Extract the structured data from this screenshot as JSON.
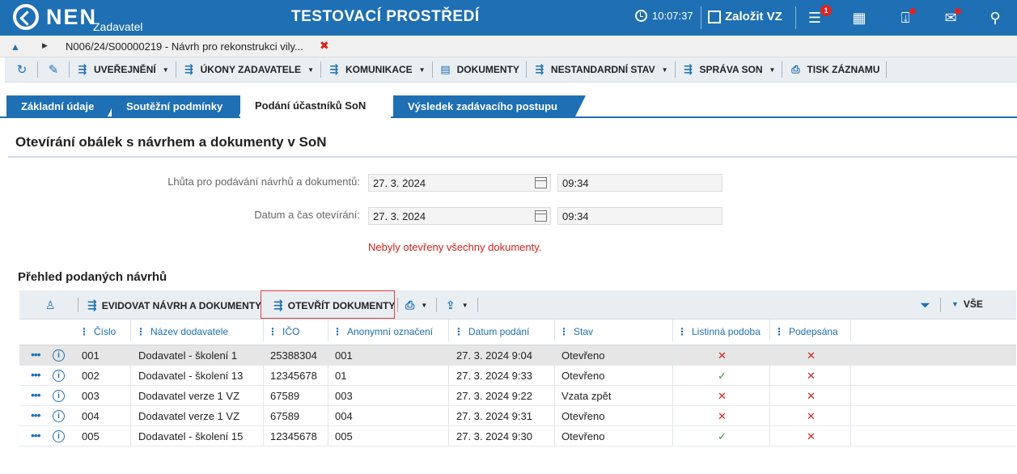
{
  "header": {
    "brand": "NEN",
    "brand_sub": "Zadavatel",
    "env_title": "TESTOVACÍ PROSTŘEDÍ",
    "clock": "10:07:37",
    "create_label": "Založit VZ",
    "tasks_badge": "1"
  },
  "breadcrumb": {
    "text": "N006/24/S00000219 - Návrh pro rekonstrukci vily...",
    "close": "✖"
  },
  "toolbar": {
    "items": [
      {
        "label": "UVEŘEJNĚNÍ"
      },
      {
        "label": "ÚKONY ZADAVATELE"
      },
      {
        "label": "KOMUNIKACE"
      },
      {
        "label": "DOKUMENTY"
      },
      {
        "label": "NESTANDARDNÍ STAV"
      },
      {
        "label": "SPRÁVA SON"
      },
      {
        "label": "TISK ZÁZNAMU"
      }
    ]
  },
  "tabs": [
    {
      "label": "Základní údaje"
    },
    {
      "label": "Soutěžní podmínky"
    },
    {
      "label": "Podání účastníků SoN"
    },
    {
      "label": "Výsledek zadávacího postupu"
    }
  ],
  "section": {
    "title": "Otevírání obálek s návrhem a dokumenty v SoN",
    "deadline_label": "Lhůta pro podávání návrhů a dokumentů:",
    "deadline_date": "27. 3. 2024",
    "deadline_time": "09:34",
    "opening_label": "Datum a čas otevírání:",
    "opening_date": "27. 3. 2024",
    "opening_time": "09:34",
    "warning": "Nebyly otevřeny všechny dokumenty."
  },
  "grid": {
    "title": "Přehled podaných návrhů",
    "btn_register": "EVIDOVAT NÁVRH A DOKUMENTY",
    "btn_open": "OTEVŘÍT DOKUMENTY",
    "filter_all": "VŠE",
    "columns": [
      "Číslo",
      "Název dodavatele",
      "IČO",
      "Anonymní označení",
      "Datum podání",
      "Stav",
      "Listinná podoba",
      "Podepsána"
    ],
    "rows": [
      {
        "cislo": "001",
        "nazev": "Dodavatel - školení 1",
        "ico": "25388304",
        "anon": "001",
        "datum": "27. 3. 2024 9:04",
        "stav": "Otevřeno",
        "listinna": "x",
        "podepsana": "x"
      },
      {
        "cislo": "002",
        "nazev": "Dodavatel - školení 13",
        "ico": "12345678",
        "anon": "01",
        "datum": "27. 3. 2024 9:33",
        "stav": "Otevřeno",
        "listinna": "check",
        "podepsana": "x"
      },
      {
        "cislo": "003",
        "nazev": "Dodavatel verze 1 VZ",
        "ico": "67589",
        "anon": "003",
        "datum": "27. 3. 2024 9:22",
        "stav": "Vzata zpět",
        "listinna": "x",
        "podepsana": "x"
      },
      {
        "cislo": "004",
        "nazev": "Dodavatel verze 1 VZ",
        "ico": "67589",
        "anon": "004",
        "datum": "27. 3. 2024 9:31",
        "stav": "Otevřeno",
        "listinna": "x",
        "podepsana": "x"
      },
      {
        "cislo": "005",
        "nazev": "Dodavatel - školení 15",
        "ico": "12345678",
        "anon": "005",
        "datum": "27. 3. 2024 9:30",
        "stav": "Otevřeno",
        "listinna": "check",
        "podepsana": "x"
      }
    ]
  }
}
